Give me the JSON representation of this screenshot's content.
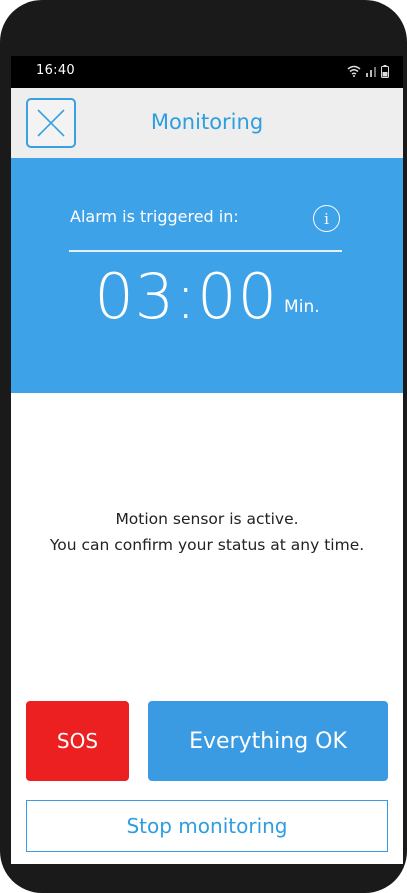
{
  "status_bar": {
    "time": "16:40"
  },
  "header": {
    "title": "Monitoring",
    "close_icon": "close-icon"
  },
  "banner": {
    "alarm_label": "Alarm is triggered in:",
    "info_glyph": "i",
    "timer_value": "03:00",
    "timer_unit": "Min.",
    "background_color": "#3ea2e8"
  },
  "message": {
    "line1": "Motion sensor is active.",
    "line2": "You can confirm your status at any time."
  },
  "actions": {
    "sos_label": "SOS",
    "ok_label": "Everything OK",
    "stop_label": "Stop monitoring",
    "sos_color": "#ec2020",
    "ok_color": "#3a9be2"
  }
}
